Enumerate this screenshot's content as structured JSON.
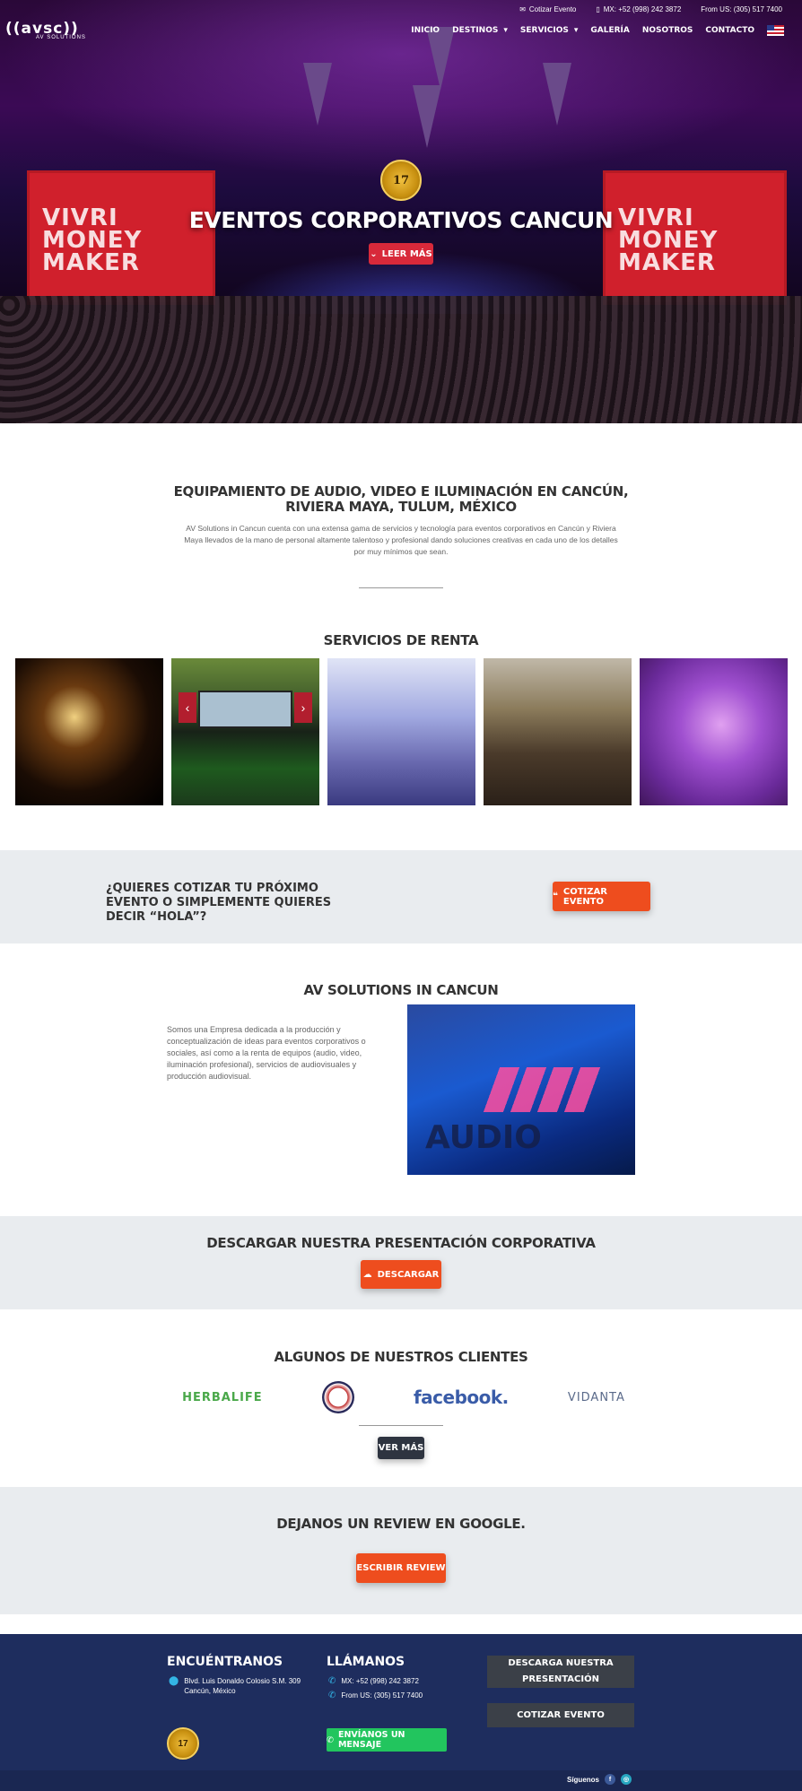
{
  "topbar": {
    "quote_link": "Cotizar Evento",
    "phone_mx": "MX: +52 (998) 242 3872",
    "phone_us": "From US: (305) 517 7400"
  },
  "logo": {
    "main": "((avsc))",
    "sub": "AV SOLUTIONS"
  },
  "nav": {
    "items": [
      "INICIO",
      "DESTINOS",
      "SERVICIOS",
      "GALERÍA",
      "NOSOTROS",
      "CONTACTO"
    ],
    "language_flag": "us-flag-icon"
  },
  "hero": {
    "badge": "17",
    "title": "EVENTOS CORPORATIVOS CANCUN",
    "button": "LEER MÁS",
    "screen_text": "VIVRI MONEY MAKER"
  },
  "intro": {
    "title": "EQUIPAMIENTO DE AUDIO, VIDEO E ILUMINACIÓN EN CANCÚN, RIVIERA MAYA, TULUM, MÉXICO",
    "text": "AV Solutions in Cancun cuenta con una extensa gama de servicios y tecnología para eventos corporativos en Cancún y Riviera Maya llevados de la mano de personal altamente talentoso y profesional dando soluciones creativas en cada uno de los detalles por muy mínimos que sean."
  },
  "services": {
    "title": "SERVICIOS DE RENTA",
    "tiles": [
      "audio-service-image",
      "video-service-image",
      "staging-service-image",
      "conference-service-image",
      "lighting-service-image"
    ]
  },
  "cta": {
    "text": "¿QUIERES COTIZAR TU PRÓXIMO EVENTO O SIMPLEMENTE QUIERES DECIR “HOLA”?",
    "button": "COTIZAR EVENTO"
  },
  "about": {
    "title": "AV SOLUTIONS IN CANCUN",
    "text": "Somos una Empresa dedicada a la producción y conceptualización de ideas para eventos corporativos o sociales, así como a la renta de equipos (audio, video, iluminación profesional), servicios de audiovisuales y producción audiovisual.",
    "image_word": "AUDIO"
  },
  "download": {
    "title": "DESCARGAR NUESTRA PRESENTACIÓN CORPORATIVA",
    "button": "DESCARGAR"
  },
  "clients": {
    "title": "ALGUNOS DE NUESTROS CLIENTES",
    "logos": [
      "HERBALIFE",
      "facebook.",
      "VIDANTA"
    ],
    "more_button": "VER MÁS"
  },
  "review": {
    "title": "DEJANOS UN REVIEW EN GOOGLE.",
    "button": "ESCRIBIR REVIEW"
  },
  "footer": {
    "find_title": "ENCUÉNTRANOS",
    "address_line1": "Blvd. Luis Donaldo Colosio S.M. 309",
    "address_line2": "Cancún, México",
    "call_title": "LLÁMANOS",
    "phone_mx": "MX: +52 (998) 242 3872",
    "phone_us": "From US: (305) 517 7400",
    "whatsapp": "ENVÍANOS UN MENSAJE",
    "download_btn": "DESCARGA NUESTRA PRESENTACIÓN",
    "quote_btn": "COTIZAR EVENTO",
    "badge": "17",
    "follow": "Síguenos"
  },
  "colors": {
    "accent_red": "#d8293a",
    "accent_orange": "#ee4d1e",
    "footer_blue": "#1e2d5e",
    "band_gray": "#e9ecef",
    "whatsapp_green": "#22c55e"
  }
}
